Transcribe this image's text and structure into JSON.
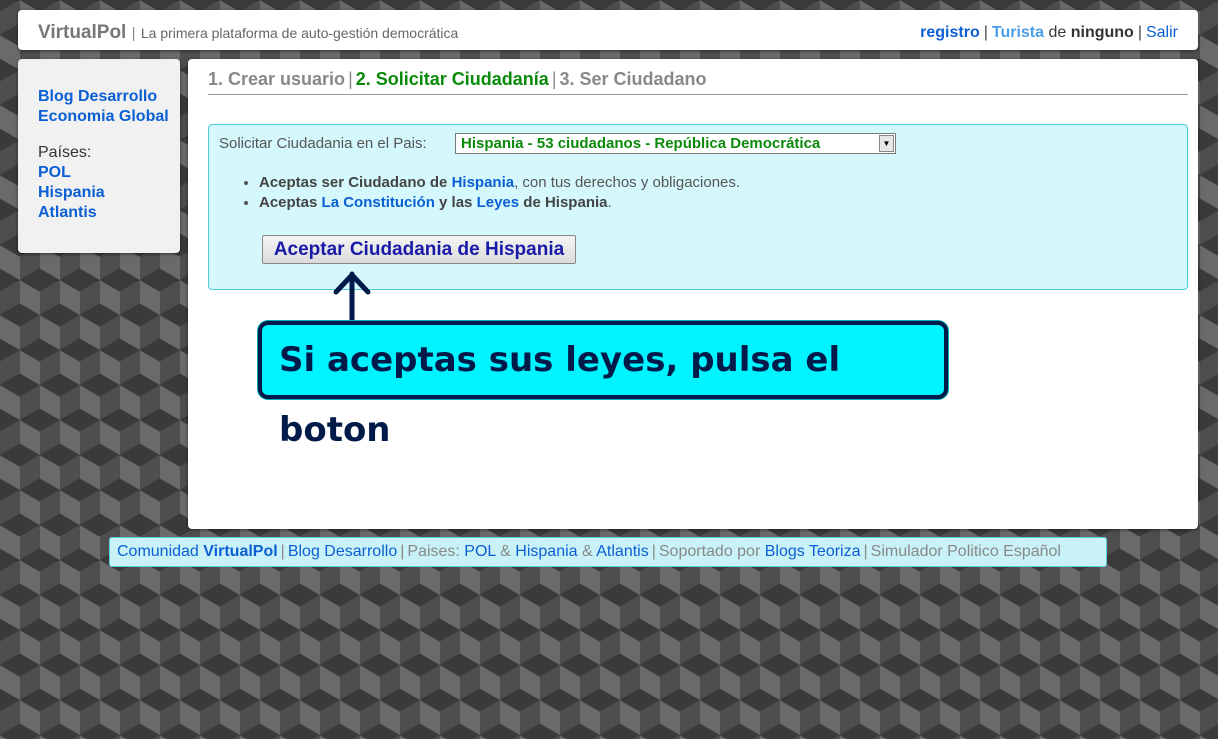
{
  "header": {
    "brand": "VirtualPol",
    "separator": "|",
    "tagline": "La primera plataforma de auto-gestión democrática",
    "user": {
      "register_link": "registro",
      "tourist_link": "Turista",
      "of_text": "de",
      "nobody_text": "ninguno",
      "logout_link": "Salir",
      "separator": "|"
    }
  },
  "sidebar": {
    "links": [
      "Blog Desarrollo",
      "Economia Global"
    ],
    "countries_label": "Países:",
    "countries": [
      "POL",
      "Hispania",
      "Atlantis"
    ]
  },
  "steps": {
    "step1": "1. Crear usuario",
    "step2": "2. Solicitar Ciudadanía",
    "step3": "3. Ser Ciudadano",
    "separator": "|"
  },
  "form": {
    "select_label": "Solicitar Ciudadania en el Pais:",
    "selected_country": "Hispania - 53 ciudadanos - República Democrática",
    "terms": [
      {
        "p1": "Aceptas ser Ciudadano de",
        "link": "Hispania",
        "p2": ", con tus derechos y obligaciones."
      },
      {
        "p1": "Aceptas",
        "link1": "La Constitución",
        "mid": "y las",
        "link2": "Leyes",
        "p2": "de Hispania",
        "end": "."
      }
    ],
    "accept_button": "Aceptar Ciudadania de Hispania"
  },
  "callout": {
    "text": "Si aceptas sus leyes, pulsa el boton"
  },
  "footer": {
    "community_text": "Comunidad",
    "community_link": "VirtualPol",
    "blog_link": "Blog Desarrollo",
    "countries_label": "Paises:",
    "countries": [
      "POL",
      "Hispania",
      "Atlantis"
    ],
    "amp": "&",
    "supported_text": "Soportado por",
    "supported_link": "Blogs Teoriza",
    "simulator_text": "Simulador Politico Español",
    "separator": "|"
  },
  "colors": {
    "link": "#0b5fd4",
    "active_step": "#0a8a0a",
    "panel_bg": "#d4f8fc",
    "callout_bg": "#00f4ff",
    "callout_border": "#001a4a"
  },
  "icons": {
    "select_arrow": "dropdown-arrow-icon",
    "callout_arrow": "up-arrow-icon"
  }
}
